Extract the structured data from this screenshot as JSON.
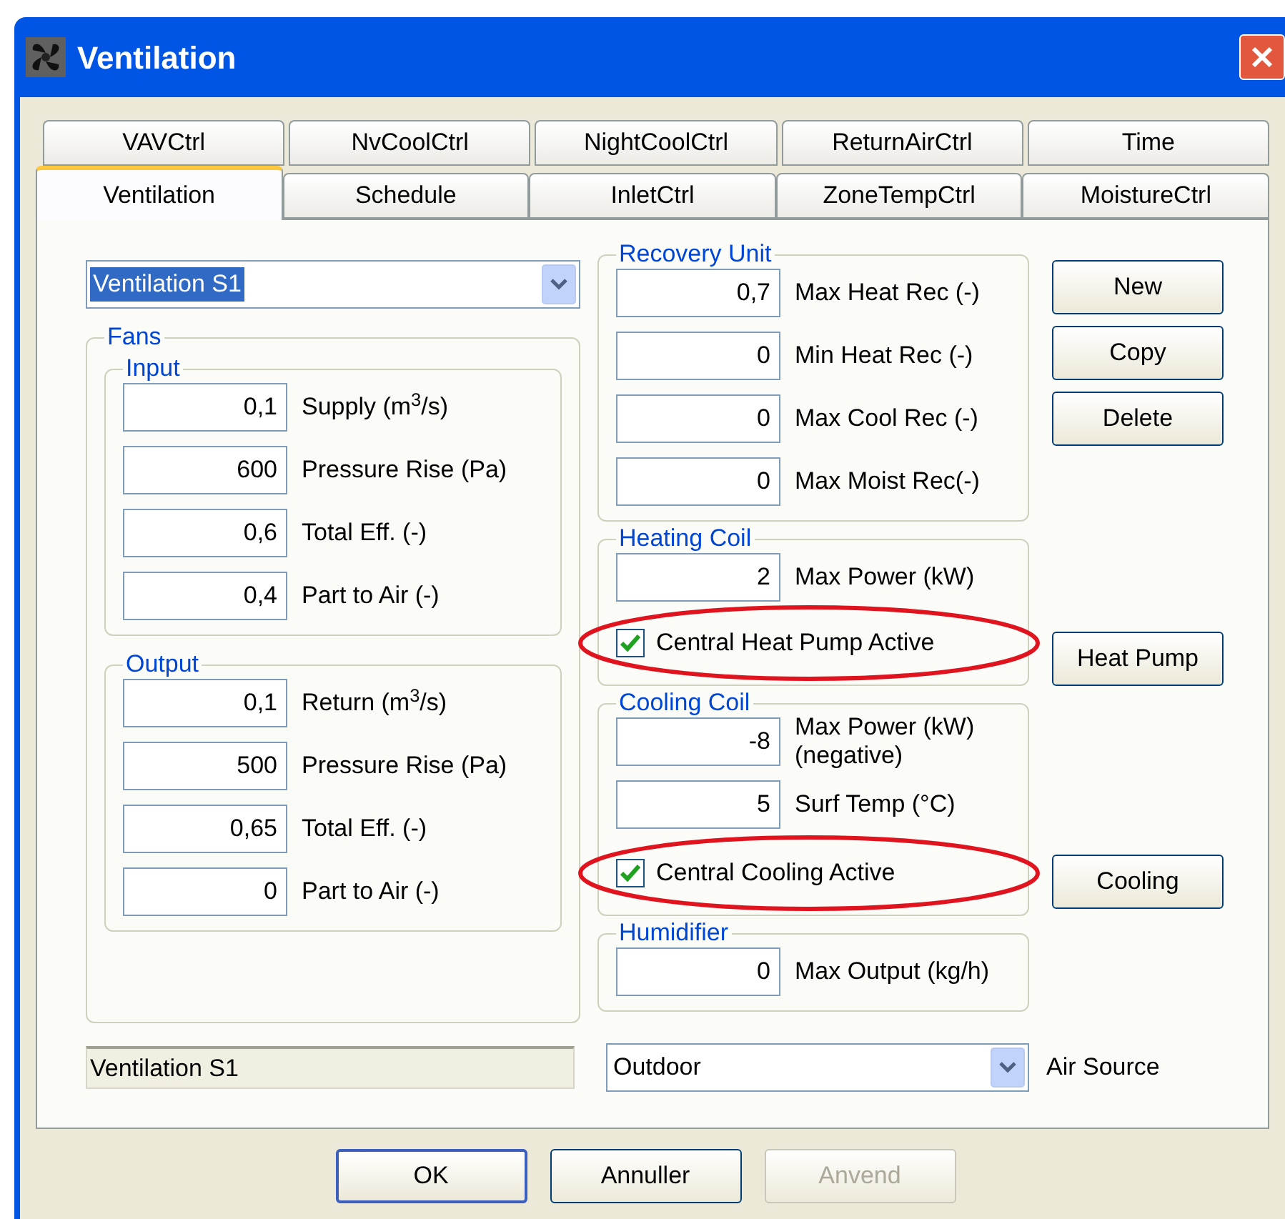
{
  "window": {
    "title": "Ventilation"
  },
  "tab_rows": [
    [
      {
        "label": "VAVCtrl",
        "selected": false
      },
      {
        "label": "NvCoolCtrl",
        "selected": false
      },
      {
        "label": "NightCoolCtrl",
        "selected": false
      },
      {
        "label": "ReturnAirCtrl",
        "selected": false
      },
      {
        "label": "Time",
        "selected": false
      }
    ],
    [
      {
        "label": "Ventilation",
        "selected": true
      },
      {
        "label": "Schedule",
        "selected": false
      },
      {
        "label": "InletCtrl",
        "selected": false
      },
      {
        "label": "ZoneTempCtrl",
        "selected": false
      },
      {
        "label": "MoistureCtrl",
        "selected": false
      }
    ]
  ],
  "ventilation_select": {
    "value": "Ventilation S1"
  },
  "fans": {
    "title": "Fans",
    "groups": [
      {
        "title": "Input",
        "fields": [
          {
            "value": "0,1",
            "label": "Supply (m$^{3}$/s)"
          },
          {
            "value": "600",
            "label": "Pressure Rise (Pa)"
          },
          {
            "value": "0,6",
            "label": "Total Eff. (-)"
          },
          {
            "value": "0,4",
            "label": "Part to Air (-)"
          }
        ]
      },
      {
        "title": "Output",
        "fields": [
          {
            "value": "0,1",
            "label": "Return (m$^{3}$/s)"
          },
          {
            "value": "500",
            "label": "Pressure Rise (Pa)"
          },
          {
            "value": "0,65",
            "label": "Total Eff. (-)"
          },
          {
            "value": "0",
            "label": "Part to Air (-)"
          }
        ]
      }
    ]
  },
  "recovery_unit": {
    "title": "Recovery Unit",
    "fields": [
      {
        "value": "0,7",
        "label": "Max Heat Rec (-)"
      },
      {
        "value": "0",
        "label": "Min Heat Rec (-)"
      },
      {
        "value": "0",
        "label": "Max Cool Rec (-)"
      },
      {
        "value": "0",
        "label": "Max Moist Rec(-)"
      }
    ]
  },
  "heating_coil": {
    "title": "Heating Coil",
    "fields": [
      {
        "value": "2",
        "label": "Max Power (kW)"
      }
    ],
    "checkbox": {
      "label": "Central Heat Pump Active",
      "checked": true
    }
  },
  "cooling_coil": {
    "title": "Cooling Coil",
    "fields": [
      {
        "value": "-8",
        "label": "Max Power (kW) (negative)"
      },
      {
        "value": "5",
        "label": "Surf Temp (°C)"
      }
    ],
    "checkbox": {
      "label": "Central Cooling Active",
      "checked": true
    }
  },
  "humidifier": {
    "title": "Humidifier",
    "fields": [
      {
        "value": "0",
        "label": "Max Output (kg/h)"
      }
    ]
  },
  "side_buttons": [
    "New",
    "Copy",
    "Delete"
  ],
  "heat_pump_button": "Heat Pump",
  "cooling_button": "Cooling",
  "name_field": {
    "value": "Ventilation S1"
  },
  "air_source": {
    "value": "Outdoor",
    "label": "Air Source"
  },
  "dialog_buttons": [
    {
      "label": "OK",
      "disabled": false,
      "default": true
    },
    {
      "label": "Annuller",
      "disabled": false,
      "default": false
    },
    {
      "label": "Anvend",
      "disabled": true,
      "default": false
    }
  ]
}
